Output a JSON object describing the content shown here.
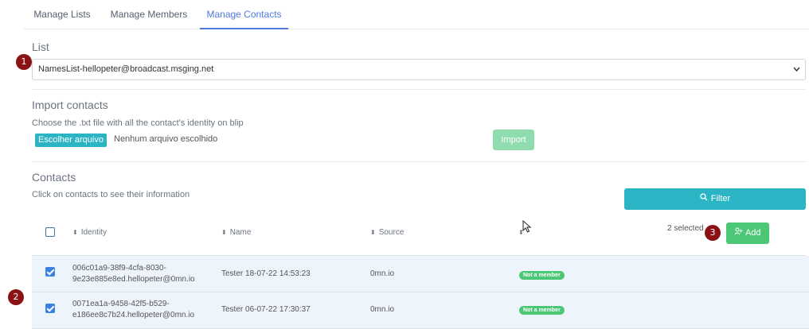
{
  "tabs": [
    {
      "label": "Manage Lists",
      "active": false
    },
    {
      "label": "Manage Members",
      "active": false
    },
    {
      "label": "Manage Contacts",
      "active": true
    }
  ],
  "list_section": {
    "title": "List",
    "selected_list": "NamesList-hellopeter@broadcast.msging.net"
  },
  "import_section": {
    "title": "Import contacts",
    "hint": "Choose the .txt file with all the contact's identity on blip",
    "file_button_label": "Escolher arquivo",
    "file_status": "Nenhum arquivo escolhido",
    "import_button_label": "Import"
  },
  "contacts_section": {
    "title": "Contacts",
    "hint": "Click on contacts to see their information",
    "filter_button_label": "Filter",
    "selected_count": "2 selected",
    "add_button_label": "Add",
    "columns": [
      "Identity",
      "Name",
      "Source"
    ],
    "rows": [
      {
        "identity_line1": "006c01a9-38f9-4cfa-8030-",
        "identity_line2": "9e23e885e8ed.hellopeter@0mn.io",
        "name": "Tester 18-07-22 14:53:23",
        "source": "0mn.io",
        "status": "Not a member",
        "checked": true
      },
      {
        "identity_line1": "0071ea1a-9458-42f5-b529-",
        "identity_line2": "e186ee8c7b24.hellopeter@0mn.io",
        "name": "Tester 06-07-22 17:30:37",
        "source": "0mn.io",
        "status": "Not a member",
        "checked": true
      }
    ]
  },
  "markers": [
    "1",
    "2",
    "3"
  ],
  "colors": {
    "accent_tab": "#4f7ae0",
    "teal_button": "#2bb5c4",
    "green_button": "#4cc776",
    "marker": "#8b1214",
    "selected_row": "#eef4fb"
  }
}
